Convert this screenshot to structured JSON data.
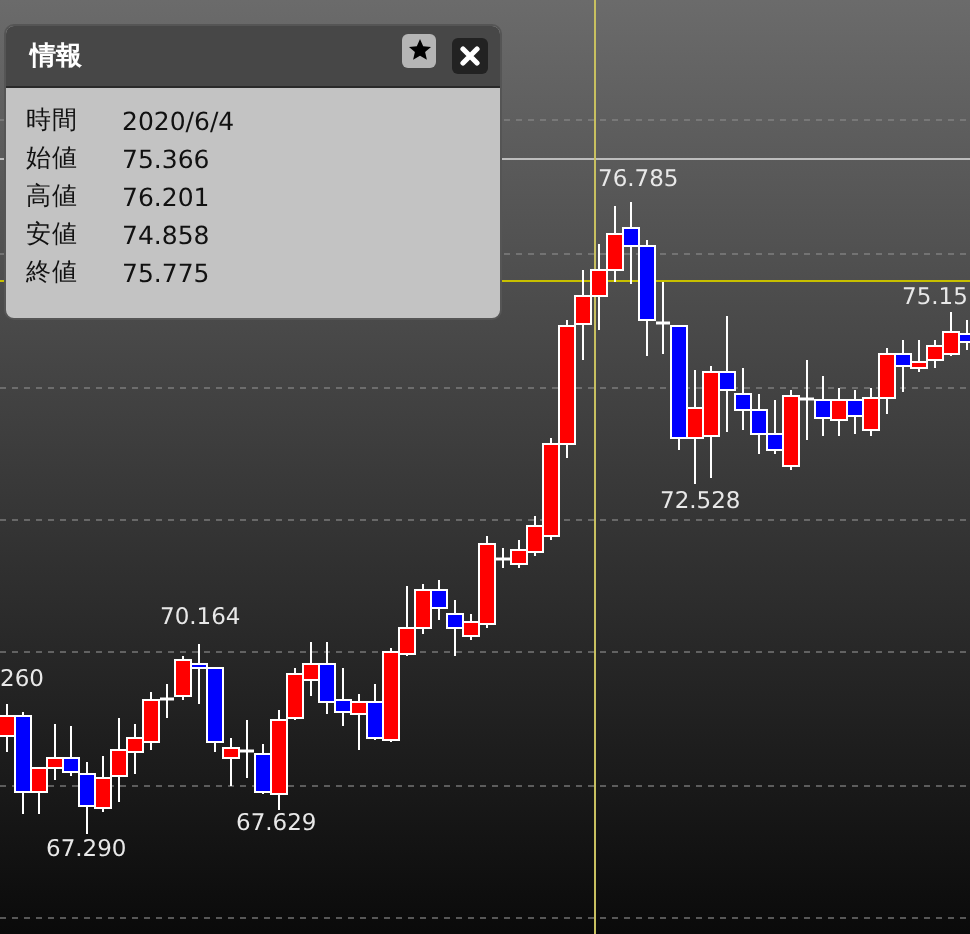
{
  "info_panel": {
    "title": "情報",
    "rows": [
      {
        "label": "時間",
        "value": "2020/6/4"
      },
      {
        "label": "始値",
        "value": "75.366"
      },
      {
        "label": "高値",
        "value": "76.201"
      },
      {
        "label": "安値",
        "value": "74.858"
      },
      {
        "label": "終値",
        "value": "75.775"
      }
    ]
  },
  "chart": {
    "price_labels": [
      "76.785",
      "75.15",
      "72.528",
      "70.164",
      "260",
      "67.629",
      "67.290"
    ]
  }
}
